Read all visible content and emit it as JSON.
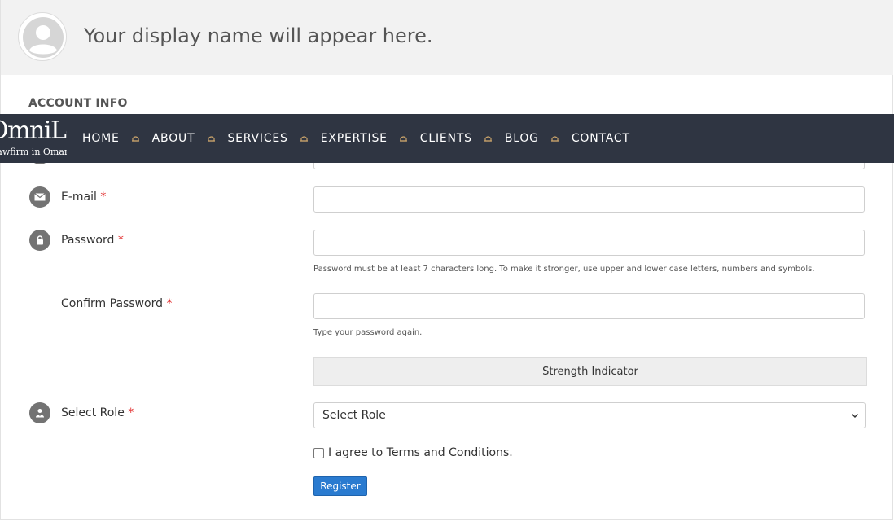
{
  "header": {
    "display_name": "Your display name will appear here."
  },
  "section": {
    "title": "ACCOUNT INFO"
  },
  "nav": {
    "logo_main": "OmniLegal",
    "logo_sub": "Lawfirm in Oman",
    "items": [
      "HOME",
      "ABOUT",
      "SERVICES",
      "EXPERTISE",
      "CLIENTS",
      "BLOG",
      "CONTACT"
    ],
    "separator_icon": "gavel-icon"
  },
  "form": {
    "email": {
      "label": "E-mail",
      "required_mark": "*",
      "icon": "envelope-icon",
      "value": ""
    },
    "password": {
      "label": "Password",
      "required_mark": "*",
      "icon": "lock-icon",
      "value": "",
      "hint": "Password must be at least 7 characters long. To make it stronger, use upper and lower case letters, numbers and symbols."
    },
    "confirm_password": {
      "label": "Confirm Password",
      "required_mark": "*",
      "value": "",
      "hint": "Type your password again."
    },
    "strength_indicator": "Strength Indicator",
    "role": {
      "label": "Select Role",
      "required_mark": "*",
      "icon": "user-role-icon",
      "selected": "Select Role"
    },
    "terms": {
      "label": "I agree to Terms and Conditions.",
      "checked": false
    },
    "register_label": "Register"
  },
  "colors": {
    "navbar_bg": "#2f3542",
    "nav_separator": "#c8a26a",
    "header_bg": "#f2f2f2",
    "button_bg": "#2a7bd0",
    "required": "#e02020"
  }
}
